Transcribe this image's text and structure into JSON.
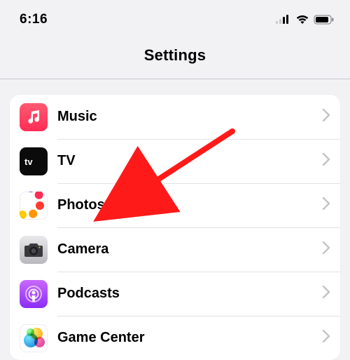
{
  "statusbar": {
    "time": "6:16"
  },
  "header": {
    "title": "Settings"
  },
  "rows": {
    "music": {
      "label": "Music"
    },
    "tv": {
      "label": "TV"
    },
    "photos": {
      "label": "Photos"
    },
    "camera": {
      "label": "Camera"
    },
    "podcasts": {
      "label": "Podcasts"
    },
    "gamecenter": {
      "label": "Game Center"
    }
  },
  "annotation": {
    "target": "photos",
    "color": "#ff1a1a"
  }
}
